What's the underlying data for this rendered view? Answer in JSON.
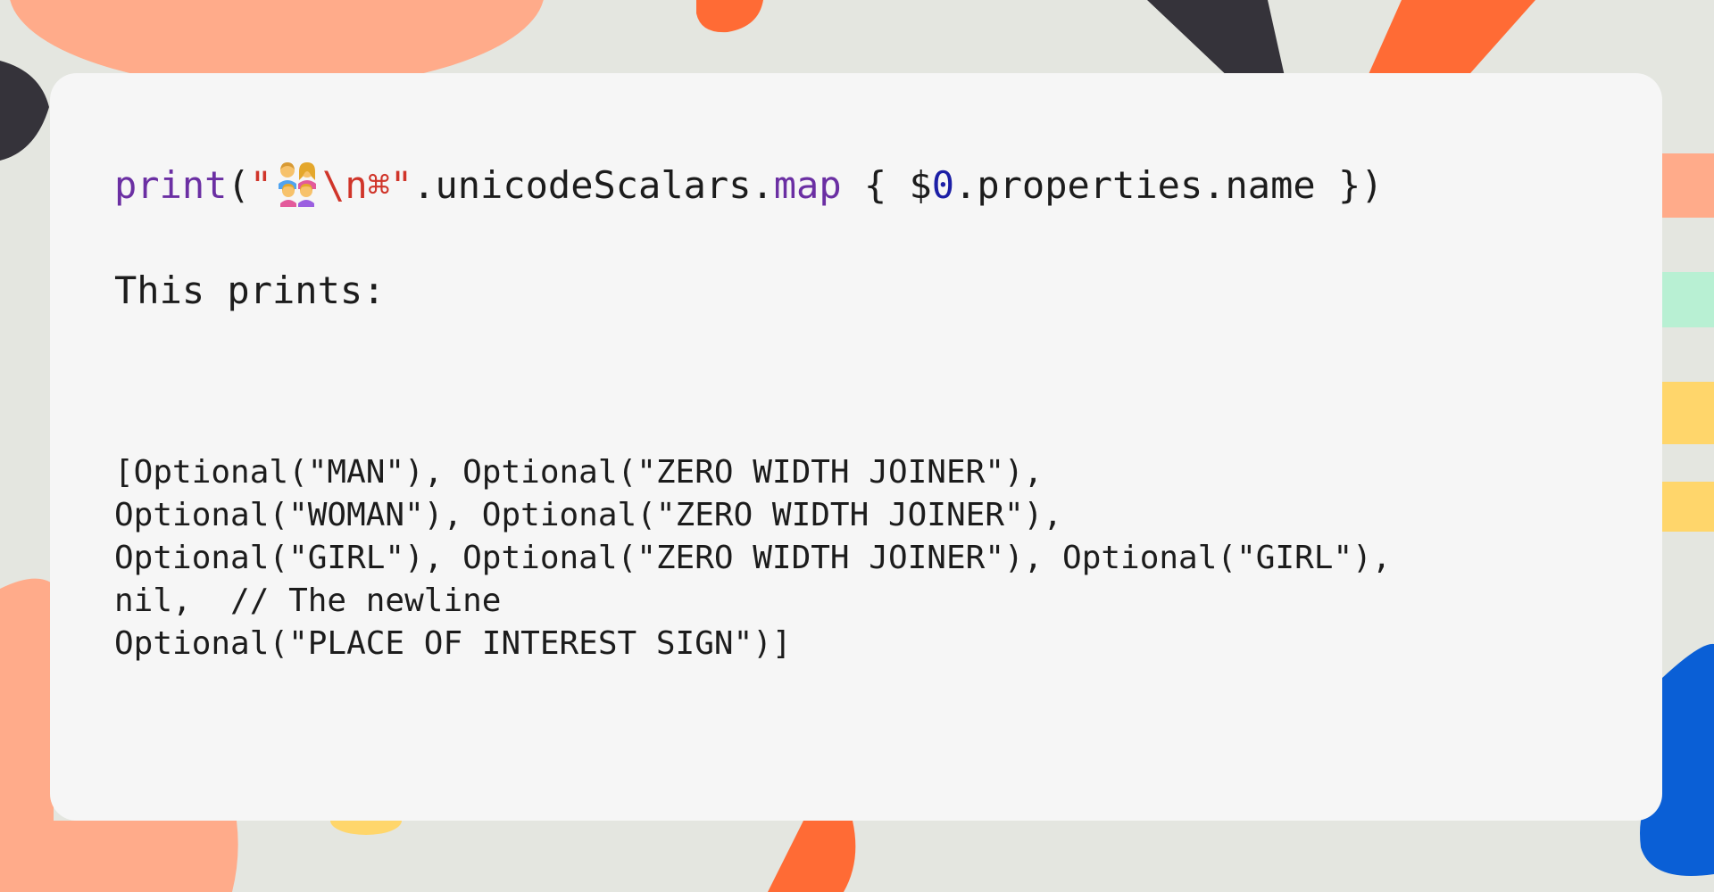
{
  "colors": {
    "background": "#e4e6e0",
    "card": "#f6f6f6",
    "function": "#6b2fa3",
    "string": "#d0352a",
    "number": "#1c1fa6",
    "text": "#1c1c1c",
    "shape_orange": "#ff6b35",
    "shape_peach": "#ffab8a",
    "shape_dark": "#35333a",
    "shape_blue": "#0a5fd6",
    "shape_yellow": "#ffd66b",
    "shape_mint": "#b8f0d3"
  },
  "code": {
    "fn_print": "print",
    "open_paren": "(",
    "quote_open": "\"",
    "emoji_name": "family-man-woman-girl-girl-emoji",
    "escape_and_symbol": "\\n⌘",
    "quote_close": "\"",
    "chain": ".unicodeScalars.",
    "fn_map": "map",
    "closure_open": " { $",
    "param_num": "0",
    "closure_rest": ".properties.name })"
  },
  "prose": {
    "label": "This prints:"
  },
  "output": {
    "lines": [
      "[Optional(\"MAN\"), Optional(\"ZERO WIDTH JOINER\"),",
      "Optional(\"WOMAN\"), Optional(\"ZERO WIDTH JOINER\"),",
      "Optional(\"GIRL\"), Optional(\"ZERO WIDTH JOINER\"), Optional(\"GIRL\"),",
      "nil,  // The newline",
      "Optional(\"PLACE OF INTEREST SIGN\")]"
    ]
  }
}
